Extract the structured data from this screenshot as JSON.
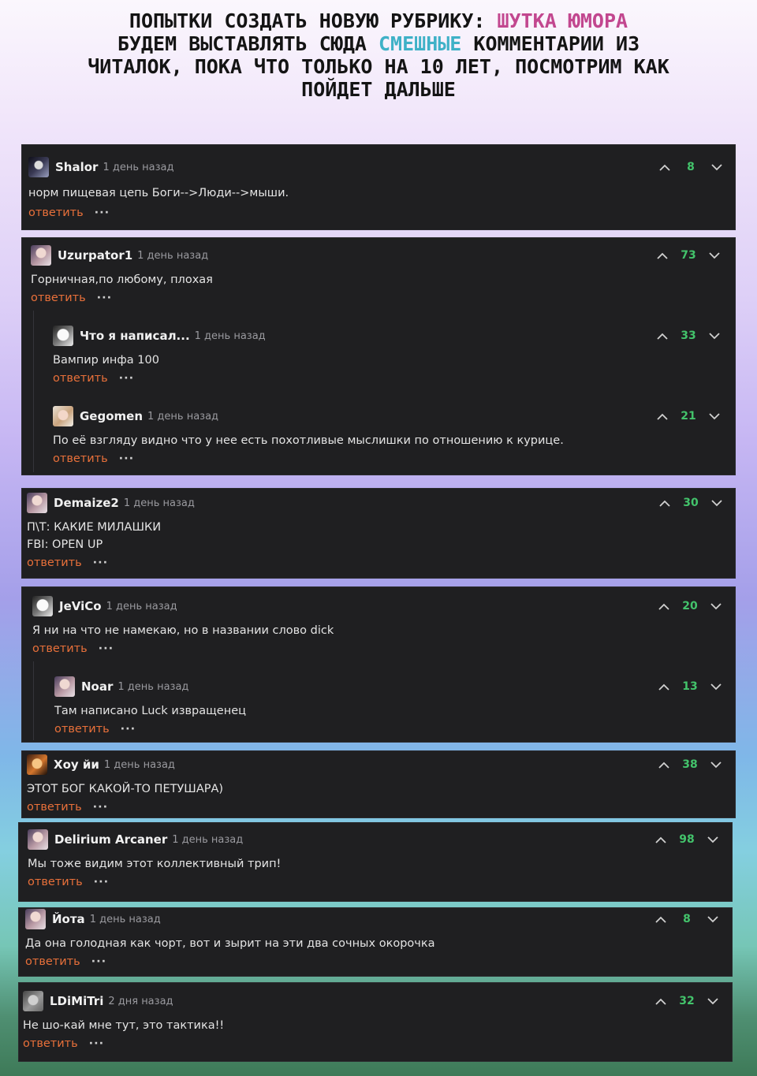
{
  "header": {
    "line1_prefix": "ПОПЫТКИ СОЗДАТЬ НОВУЮ РУБРИКУ: ",
    "line1_highlight": "ШУТКА ЮМОРА",
    "line2_prefix": "БУДЕМ ВЫСТАВЛЯТЬ СЮДА ",
    "line2_highlight": "СМЕШНЫЕ",
    "line2_suffix": " КОММЕНТАРИИ ИЗ",
    "line3": "ЧИТАЛОК, ПОКА ЧТО ТОЛЬКО НА 10 ЛЕТ, ПОСМОТРИМ КАК",
    "line4": "ПОЙДЕТ ДАЛЬШЕ",
    "highlight_colors": {
      "pink": "#c2478f",
      "cyan": "#3fb1c7"
    }
  },
  "ui": {
    "reply_label": "ответить",
    "more_label": "···",
    "score_color": "#43c36b",
    "reply_color": "#e8703a",
    "upvote_icon": "chevron-up-icon",
    "downvote_icon": "chevron-down-icon"
  },
  "comments": {
    "c1": {
      "author": "Shalor",
      "time": "1 день назад",
      "text": "норм пищевая цепь Боги-->Люди-->мыши.",
      "score": "8"
    },
    "c2": {
      "author": "Uzurpator1",
      "time": "1 день назад",
      "text": "Горничная,по любому, плохая",
      "score": "73"
    },
    "c2r1": {
      "author": "Что я написал...",
      "time": "1 день назад",
      "text": "Вампир инфа 100",
      "score": "33"
    },
    "c2r2": {
      "author": "Gegomen",
      "time": "1 день назад",
      "text": "По её взгляду видно что у нее есть похотливые мыслишки по отношению к курице.",
      "score": "21"
    },
    "c3": {
      "author": "Demaize2",
      "time": "1 день назад",
      "text_line1": "П\\Т: КАКИЕ МИЛАШКИ",
      "text_line2": "FBI: OPEN UP",
      "score": "30"
    },
    "c4": {
      "author": "JeViCo",
      "time": "1 день назад",
      "text": "Я ни на что не намекаю, но в названии слово dick",
      "score": "20"
    },
    "c4r1": {
      "author": "Noar",
      "time": "1 день назад",
      "text": "Там написано Luck извращенец",
      "score": "13"
    },
    "c5": {
      "author": "Хоу йи",
      "time": "1 день назад",
      "text": "ЭТОТ БОГ КАКОЙ-ТО ПЕТУШАРА)",
      "score": "38"
    },
    "c6": {
      "author": "Delirium Arcaner",
      "time": "1 день назад",
      "text": "Мы тоже видим этот коллективный трип!",
      "score": "98"
    },
    "c7": {
      "author": "Йота",
      "time": "1 день назад",
      "text": "Да она голодная как чорт, вот и зырит на эти два сочных окорочка",
      "score": "8"
    },
    "c8": {
      "author": "LDiMiTri",
      "time": "2 дня назад",
      "text": "Не шо-кай мне тут, это тактика!!",
      "score": "32"
    }
  }
}
